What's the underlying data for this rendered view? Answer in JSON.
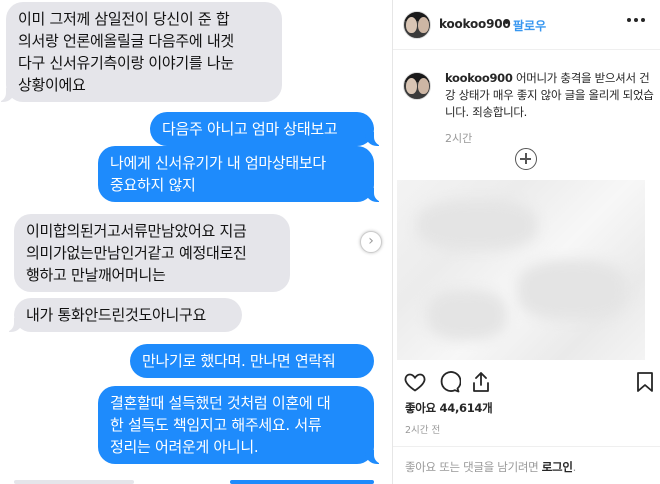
{
  "thread": {
    "messages": [
      {
        "from": "them",
        "lines": [
          "이미 그저께 삼일전이 당신이 준 합",
          "의서랑 언론에올릴글 다음주에 내겟",
          "다구 신서유기측이랑 이야기를 나눈",
          "상황이에요"
        ]
      },
      {
        "from": "me",
        "lines": [
          "다음주 아니고 엄마 상태보고"
        ]
      },
      {
        "from": "me",
        "lines": [
          "나에게 신서유기가 내 엄마상태보다",
          "중요하지 않지"
        ]
      },
      {
        "from": "them",
        "lines": [
          "이미합의된거고서류만남았어요 지금",
          "의미가없는만남인거같고 예정대로진",
          "행하고 만날깨어머니는"
        ]
      },
      {
        "from": "them",
        "lines": [
          "내가 통화안드린것도아니구요"
        ]
      },
      {
        "from": "me",
        "lines": [
          "만나기로 했다며. 만나면 연락줘"
        ]
      },
      {
        "from": "me",
        "lines": [
          "결혼할때 설득했던 것처럼 이혼에 대",
          "한 설득도 책임지고 해주세요. 서류",
          "정리는 어려운게 아니니."
        ]
      }
    ]
  },
  "post": {
    "username": "kookoo900",
    "separator": "•",
    "follow_label": "팔로우",
    "caption_user": "kookoo900",
    "caption_text": "어머니가 충격을 받으셔서 건강 상태가 매우 좋지 않아 글을 올리게 되었습니다. 죄송합니다.",
    "caption_time": "2시간",
    "likes_text": "좋아요 44,614개",
    "posted_time": "2시간 전",
    "comment_prompt": "좋아요 또는 댓글을 남기려면 ",
    "login_label": "로그인",
    "comment_suffix": "."
  },
  "icons": [
    "more-icon",
    "add-icon",
    "heart-icon",
    "comment-icon",
    "share-icon",
    "bookmark-icon",
    "chevron-right-icon"
  ],
  "colors": {
    "incoming": "#e5e5ea",
    "outgoing": "#1e8bfc",
    "link": "#3897f0"
  }
}
